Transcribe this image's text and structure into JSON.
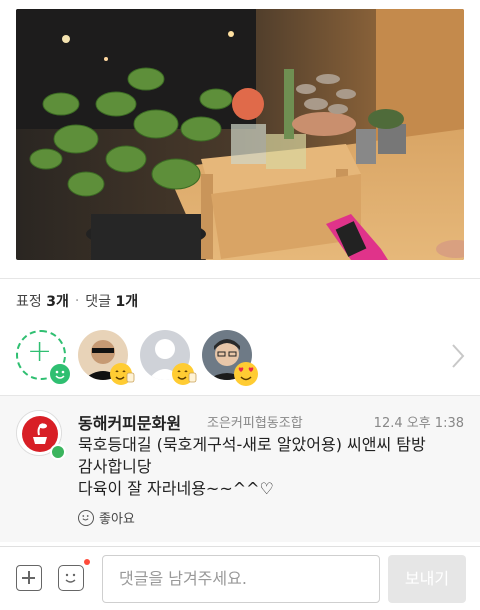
{
  "post": {
    "photo_alt": "succulent plants on wooden shelf"
  },
  "reaction_counts": {
    "label_emotion": "표정",
    "emotion_count": "3개",
    "separator": "·",
    "label_comment": "댓글",
    "comment_count": "1개"
  },
  "reactions": [
    {
      "user": "user1",
      "badge": "thumbs-up-emoji"
    },
    {
      "user": "user2",
      "badge": "thumbs-up-emoji"
    },
    {
      "user": "user3",
      "badge": "heart-eyes-emoji"
    }
  ],
  "comment": {
    "author": "동해커피문화원",
    "group": "조은커피협동조합",
    "time": "12.4 오후 1:38",
    "lines": [
      "묵호등대길 (묵호게구석-새로 알았어용) 씨앤씨 탐방",
      "감사합니당",
      "다육이 잘 자라네용~~^^♡"
    ],
    "like_label": "좋아요"
  },
  "composer": {
    "placeholder": "댓글을 남겨주세요.",
    "send_label": "보내기"
  },
  "colors": {
    "accent_green": "#2fbf71",
    "notification_red": "#ff4b3a"
  }
}
